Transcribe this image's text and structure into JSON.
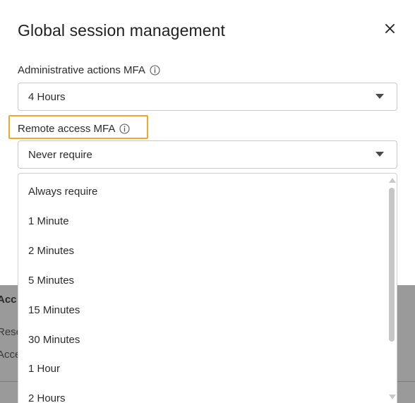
{
  "background": {
    "heading_fragment": "Acc",
    "line1_fragment": "Rese",
    "line2_fragment": "Acce"
  },
  "modal": {
    "title": "Global session management",
    "close_icon": "close-icon",
    "admin_field": {
      "label": "Administrative actions MFA",
      "icon": "info-icon",
      "value": "4 Hours"
    },
    "remote_field": {
      "label": "Remote access MFA",
      "icon": "info-icon",
      "value": "Never require",
      "highlight_color": "#f0a82a"
    },
    "dropdown": {
      "options": [
        "Always require",
        "1 Minute",
        "2 Minutes",
        "5 Minutes",
        "15 Minutes",
        "30 Minutes",
        "1 Hour",
        "2 Hours"
      ]
    }
  }
}
